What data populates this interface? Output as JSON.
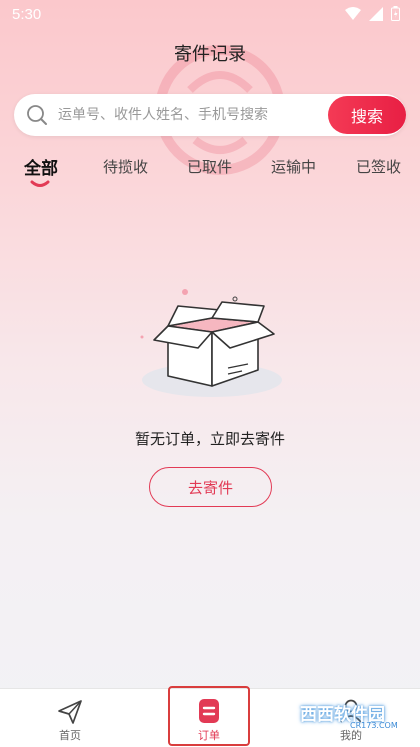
{
  "status_bar": {
    "time": "5:30"
  },
  "header": {
    "title": "寄件记录"
  },
  "search": {
    "placeholder": "运单号、收件人姓名、手机号搜索",
    "button_label": "搜索"
  },
  "tabs": [
    {
      "label": "全部",
      "active": true
    },
    {
      "label": "待揽收",
      "active": false
    },
    {
      "label": "已取件",
      "active": false
    },
    {
      "label": "运输中",
      "active": false
    },
    {
      "label": "已签收",
      "active": false
    }
  ],
  "empty_state": {
    "message": "暂无订单，立即去寄件",
    "button_label": "去寄件"
  },
  "bottom_nav": [
    {
      "label": "首页",
      "icon": "paper-plane-icon",
      "active": false
    },
    {
      "label": "订单",
      "icon": "order-list-icon",
      "active": true
    },
    {
      "label": "我的",
      "icon": "profile-icon",
      "active": false
    }
  ],
  "watermark": {
    "text": "西西软件园",
    "sub": "CR173.COM"
  },
  "colors": {
    "accent": "#e23a55",
    "highlight_box": "#d93d3d"
  }
}
